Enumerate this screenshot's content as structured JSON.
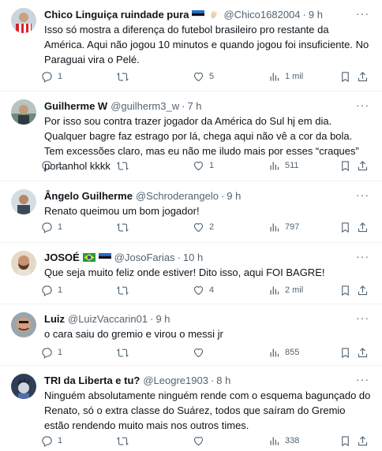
{
  "colors": {
    "text": "#0f1419",
    "secondary": "#536471",
    "divider": "#eff3f4"
  },
  "icons": {
    "reply": "reply-icon",
    "retweet": "retweet-icon",
    "like": "heart-icon",
    "views": "views-chart-icon",
    "bookmark": "bookmark-icon",
    "share": "share-icon",
    "more": "more-icon"
  },
  "tweets": [
    {
      "name": "Chico Linguiça ruindade pura",
      "handle": "@Chico1682004",
      "time": "9 h",
      "text": "Isso só mostra a diferença do futebol brasileiro pro restante da América. Aqui não jogou 10 minutos e quando jogou foi insuficiente. No Paraguai vira o Pelé.",
      "replies": "1",
      "retweets": "",
      "likes": "5",
      "views": "1 mil"
    },
    {
      "name": "Guilherme W",
      "handle": "@guilherm3_w",
      "time": "7 h",
      "text": "Por isso sou contra trazer jogador da América do Sul hj em dia. Qualquer bagre  faz estrago por lá, chega aqui não vê a cor da bola. Tem excessões claro, mas eu não me iludo mais por esses “craques” portanhol kkkk",
      "replies": "1",
      "retweets": "",
      "likes": "1",
      "views": "511"
    },
    {
      "name": "Ângelo Guilherme",
      "handle": "@Schroderangelo",
      "time": "9 h",
      "text": "Renato queimou um bom jogador!",
      "replies": "1",
      "retweets": "",
      "likes": "2",
      "views": "797"
    },
    {
      "name": "JOSOÉ",
      "handle": "@JosoFarias",
      "time": "10 h",
      "text": "Que seja muito feliz onde estiver! Dito isso, aqui FOI BAGRE!",
      "replies": "1",
      "retweets": "",
      "likes": "4",
      "views": "2 mil"
    },
    {
      "name": "Luiz",
      "handle": "@LuizVaccarin01",
      "time": "9 h",
      "text": "o cara saiu do gremio e virou o messi jr",
      "replies": "1",
      "retweets": "",
      "likes": "",
      "views": "855"
    },
    {
      "name": "TRI da Liberta e tu?",
      "handle": "@Leogre1903",
      "time": "8 h",
      "text": "Ninguém absolutamente ninguém rende com o esquema bagunçado do Renato, só o extra classe do Suárez, todos que saíram do Gremio estão rendendo muito mais nos outros times.",
      "replies": "1",
      "retweets": "",
      "likes": "",
      "views": "338"
    }
  ]
}
